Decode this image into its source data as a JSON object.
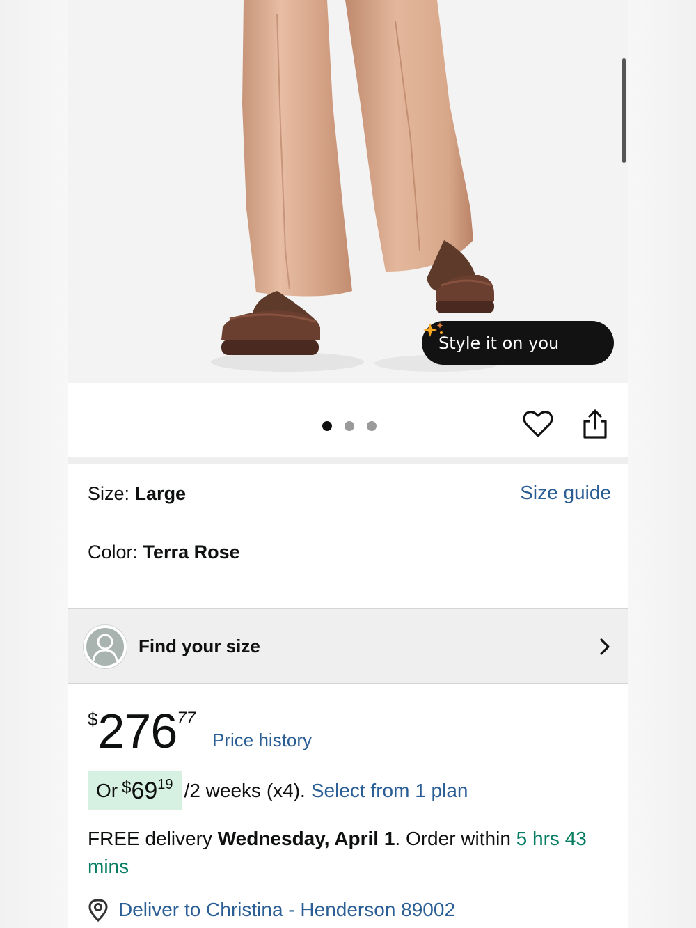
{
  "hero": {
    "style_button_label": "Style it on you",
    "style_button_icon": "sparkle-icon",
    "image_dots_total": 3,
    "image_dots_active": 1
  },
  "actions": {
    "favorite_icon": "heart-icon",
    "share_icon": "share-icon"
  },
  "variant": {
    "size_label": "Size:",
    "size_value": "Large",
    "size_guide_link": "Size guide",
    "color_label": "Color:",
    "color_value": "Terra Rose"
  },
  "find_size": {
    "label": "Find your size",
    "icon": "user-avatar-icon",
    "chevron": "chevron-right-icon"
  },
  "price": {
    "currency": "$",
    "whole": "276",
    "fraction": "77",
    "history_link": "Price history"
  },
  "installment": {
    "prefix": "Or",
    "currency": "$",
    "whole": "69",
    "fraction": "19",
    "suffix": "/2 weeks (x4).",
    "plan_link": "Select from 1 plan"
  },
  "delivery": {
    "prefix": "FREE delivery",
    "date": "Wednesday, April 1",
    "mid": ". Order within",
    "countdown": "5 hrs 43 mins"
  },
  "deliver_to": {
    "icon": "location-pin-icon",
    "label": "Deliver to Christina - Henderson 89002"
  },
  "colors": {
    "link": "#2a5e95",
    "countdown": "#067d62",
    "installment_badge": "#d6f1e2",
    "pill_bg": "#121212"
  }
}
